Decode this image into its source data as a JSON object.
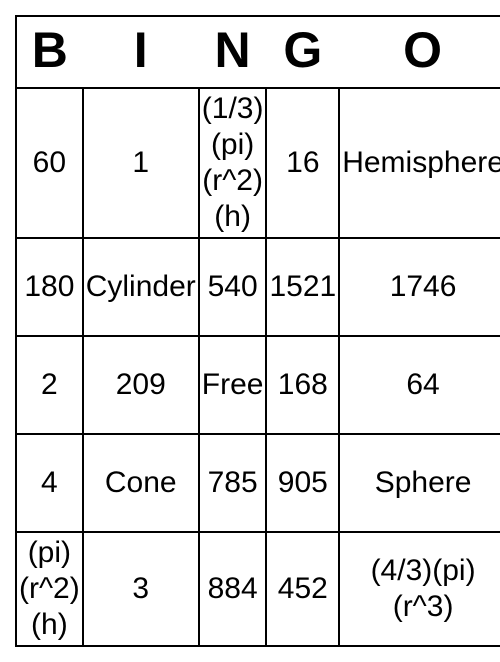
{
  "headers": [
    "B",
    "I",
    "N",
    "G",
    "O"
  ],
  "cells": {
    "r1c1": "60",
    "r1c2": "1",
    "r1c3": "(1/3)(pi)(r^2)(h)",
    "r1c4": "16",
    "r1c5": "Hemisphere",
    "r2c1": "180",
    "r2c2": "Cylinder",
    "r2c3": "540",
    "r2c4": "1521",
    "r2c5": "1746",
    "r3c1": "2",
    "r3c2": "209",
    "r3c3": "Free",
    "r3c4": "168",
    "r3c5": "64",
    "r4c1": "4",
    "r4c2": "Cone",
    "r4c3": "785",
    "r4c4": "905",
    "r4c5": "Sphere",
    "r5c1": "(pi)(r^2)(h)",
    "r5c2": "3",
    "r5c3": "884",
    "r5c4": "452",
    "r5c5": "(4/3)(pi)(r^3)"
  }
}
